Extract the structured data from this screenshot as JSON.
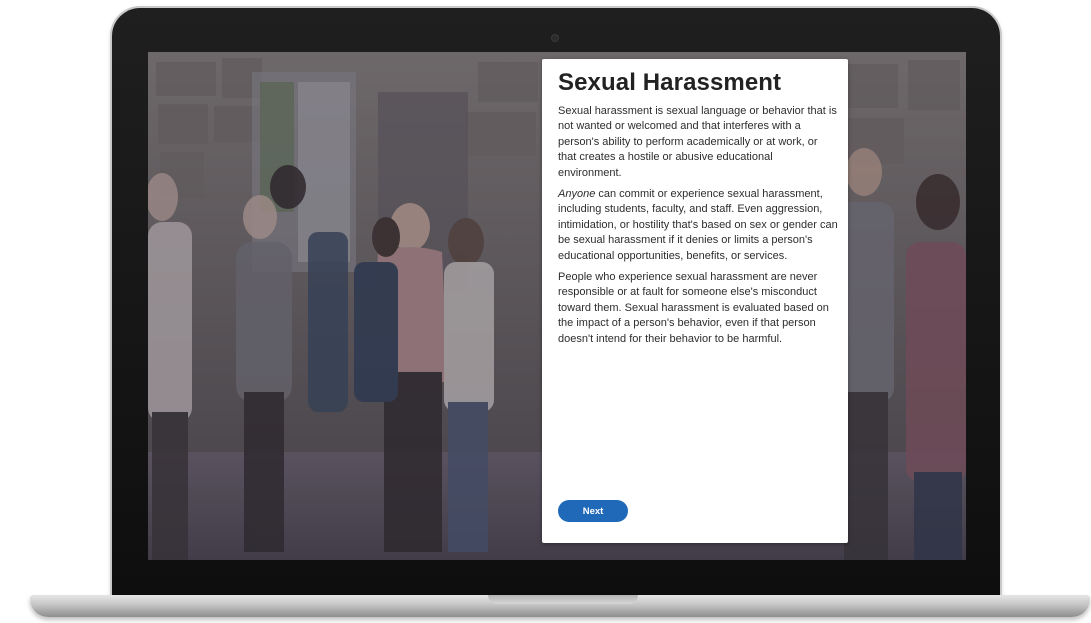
{
  "card": {
    "title": "Sexual Harassment",
    "paragraph_1": "Sexual harassment is sexual language or behavior that is not wanted or welcomed and that interferes with a person's ability to perform academically or at work, or that creates a hostile or abusive educational environment.",
    "paragraph_2_emphasis": "Anyone",
    "paragraph_2_rest": " can commit or experience sexual harassment, including students, faculty, and staff. Even aggression, intimidation, or hostility that's based on sex or gender can be sexual harassment if it denies or limits a person's educational opportunities, benefits, or services.",
    "paragraph_3": "People who experience sexual harassment are never responsible or at fault for someone else's misconduct toward them. Sexual harassment is evaluated based on the impact of a person's behavior, even if that person doesn't intend for their behavior to be harmful.",
    "next_label": "Next"
  },
  "colors": {
    "button": "#2069b8",
    "title": "#222222",
    "body_text": "#2d2d2d",
    "laptop_bezel": "#111111"
  }
}
